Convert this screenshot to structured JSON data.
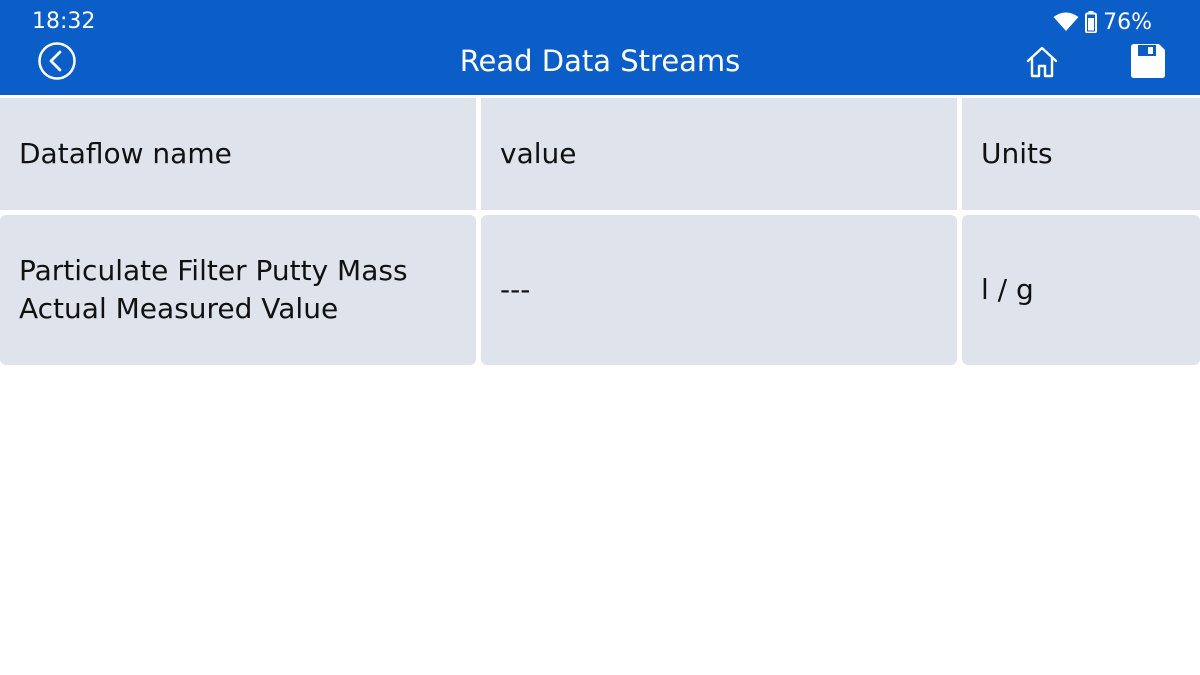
{
  "status_bar": {
    "time": "18:32",
    "battery_percent": "76%",
    "icons": [
      "wifi-icon",
      "battery-icon"
    ]
  },
  "header": {
    "title": "Read Data Streams",
    "icons": [
      "back-icon",
      "home-icon",
      "save-icon"
    ]
  },
  "table": {
    "columns": [
      "Dataflow name",
      "value",
      "Units"
    ],
    "rows": [
      {
        "name": "Particulate Filter Putty Mass Actual Measured Value",
        "value": "---",
        "units": "l / g"
      }
    ]
  },
  "colors": {
    "header_bg": "#0b5dc8",
    "cell_bg": "#dfe3ec",
    "page_bg": "#ffffff"
  }
}
